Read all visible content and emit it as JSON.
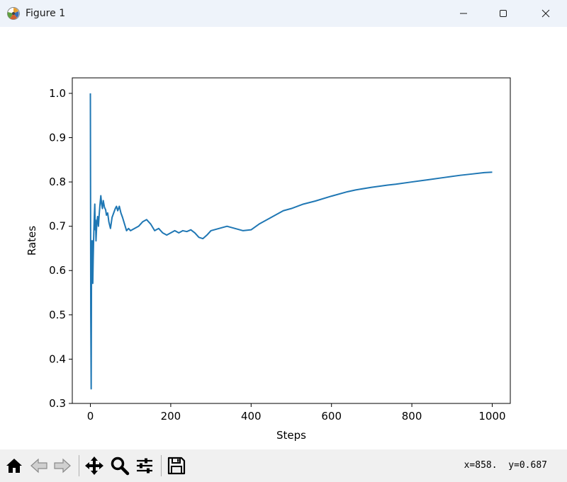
{
  "window": {
    "title": "Figure 1",
    "icons": [
      "matplotlib-logo-icon",
      "minimize-icon",
      "maximize-icon",
      "close-icon"
    ]
  },
  "toolbar": {
    "tools": [
      "home-icon",
      "back-icon",
      "forward-icon",
      "pan-icon",
      "zoom-icon",
      "subplots-config-icon",
      "save-icon"
    ],
    "coordinates": "x=858.  y=0.687"
  },
  "chart_data": {
    "type": "line",
    "xlabel": "Steps",
    "ylabel": "Rates",
    "xlim": [
      -45,
      1045
    ],
    "ylim": [
      0.3,
      1.035
    ],
    "xticks": [
      0,
      200,
      400,
      600,
      800,
      1000
    ],
    "yticks": [
      0.3,
      0.4,
      0.5,
      0.6,
      0.7,
      0.8,
      0.9,
      1.0
    ],
    "xtick_labels": [
      "0",
      "200",
      "400",
      "600",
      "800",
      "1000"
    ],
    "ytick_labels": [
      "0.3",
      "0.4",
      "0.5",
      "0.6",
      "0.7",
      "0.8",
      "0.9",
      "1.0"
    ],
    "grid": false,
    "line_color": "#1f77b4",
    "series": [
      {
        "x": [
          0,
          1,
          2,
          3,
          4,
          5,
          6,
          7,
          8,
          9,
          10,
          11,
          12,
          13,
          14,
          15,
          16,
          18,
          20,
          22,
          24,
          26,
          28,
          30,
          32,
          35,
          38,
          40,
          43,
          46,
          50,
          54,
          58,
          62,
          65,
          68,
          72,
          76,
          80,
          85,
          90,
          95,
          100,
          110,
          120,
          130,
          140,
          150,
          160,
          170,
          180,
          190,
          200,
          210,
          220,
          230,
          240,
          250,
          260,
          270,
          280,
          290,
          300,
          320,
          340,
          360,
          380,
          400,
          420,
          450,
          480,
          500,
          530,
          560,
          600,
          640,
          660,
          700,
          740,
          760,
          800,
          840,
          880,
          920,
          950,
          980,
          1000
        ],
        "y": [
          1.0,
          0.5,
          0.333,
          0.667,
          0.6,
          0.667,
          0.571,
          0.625,
          0.667,
          0.7,
          0.727,
          0.75,
          0.692,
          0.714,
          0.667,
          0.688,
          0.706,
          0.722,
          0.7,
          0.727,
          0.75,
          0.769,
          0.75,
          0.74,
          0.758,
          0.743,
          0.737,
          0.725,
          0.73,
          0.71,
          0.695,
          0.72,
          0.73,
          0.74,
          0.745,
          0.735,
          0.745,
          0.73,
          0.72,
          0.705,
          0.69,
          0.695,
          0.69,
          0.695,
          0.7,
          0.71,
          0.715,
          0.705,
          0.69,
          0.695,
          0.685,
          0.68,
          0.685,
          0.69,
          0.685,
          0.69,
          0.688,
          0.692,
          0.685,
          0.675,
          0.672,
          0.68,
          0.69,
          0.695,
          0.7,
          0.695,
          0.69,
          0.692,
          0.705,
          0.72,
          0.735,
          0.74,
          0.75,
          0.757,
          0.768,
          0.778,
          0.782,
          0.788,
          0.793,
          0.795,
          0.8,
          0.805,
          0.81,
          0.815,
          0.818,
          0.821,
          0.822
        ]
      }
    ]
  }
}
